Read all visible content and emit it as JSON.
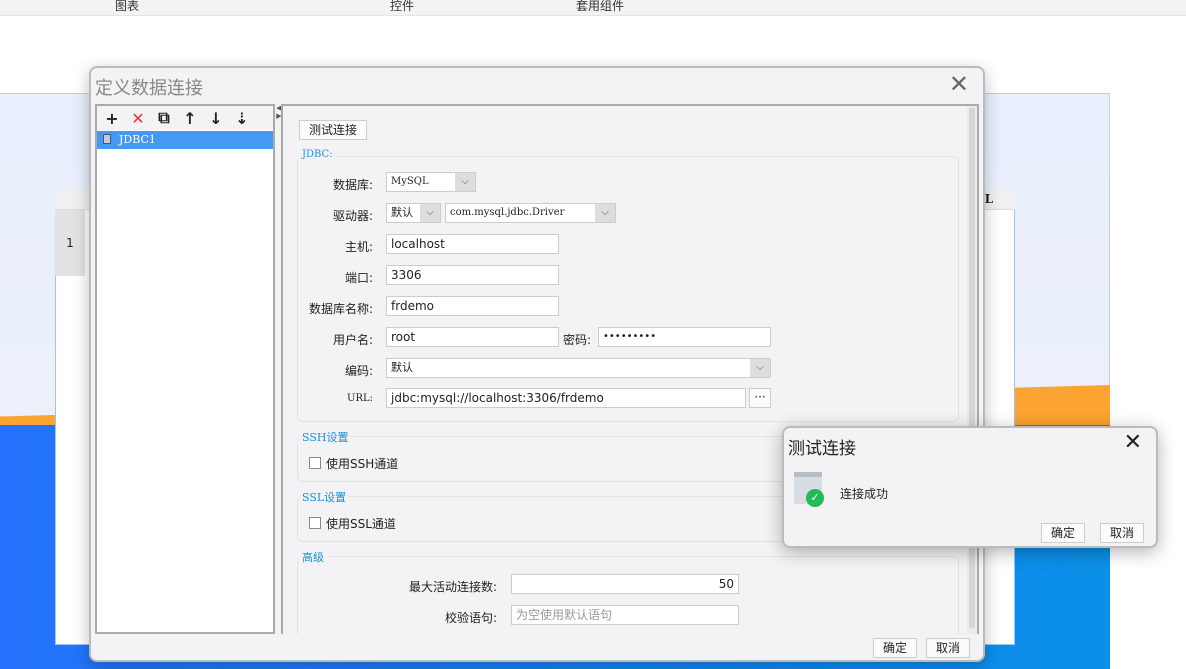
{
  "topbar": {
    "tabs": [
      "图表",
      "控件",
      "套用组件"
    ]
  },
  "sheet": {
    "row1": "1",
    "col_letter": "L"
  },
  "dialog": {
    "title": "定义数据连接",
    "toolbar": {
      "add": "+",
      "delete": "✕",
      "copy": "⧉",
      "up": "↑",
      "down": "↓",
      "sort": "⇣"
    },
    "connections": [
      "JDBC1"
    ],
    "test_button": "测试连接",
    "jdbc_legend": "JDBC:",
    "fields": {
      "database_label": "数据库:",
      "database_value": "MySQL",
      "driver_label": "驱动器:",
      "driver_mode": "默认",
      "driver_value": "com.mysql.jdbc.Driver",
      "host_label": "主机:",
      "host_value": "localhost",
      "port_label": "端口:",
      "port_value": "3306",
      "dbname_label": "数据库名称:",
      "dbname_value": "frdemo",
      "user_label": "用户名:",
      "user_value": "root",
      "password_label": "密码:",
      "password_value": "•••••••••",
      "encoding_label": "编码:",
      "encoding_value": "默认",
      "url_label": "URL:",
      "url_value": "jdbc:mysql://localhost:3306/frdemo",
      "url_more": "···"
    },
    "ssh": {
      "legend": "SSH设置",
      "checkbox": "使用SSH通道",
      "checked": false
    },
    "ssl": {
      "legend": "SSL设置",
      "checkbox": "使用SSL通道",
      "checked": false
    },
    "advanced": {
      "legend": "高级",
      "max_conn_label": "最大活动连接数:",
      "max_conn_value": "50",
      "validation_label": "校验语句:",
      "validation_placeholder": "为空使用默认语句"
    },
    "ok": "确定",
    "cancel": "取消"
  },
  "popup": {
    "title": "测试连接",
    "message": "连接成功",
    "ok": "确定",
    "cancel": "取消",
    "close": "✕"
  },
  "colors": {
    "accent": "#4499f5",
    "legend": "#1b8fd9",
    "success": "#22bb55"
  }
}
